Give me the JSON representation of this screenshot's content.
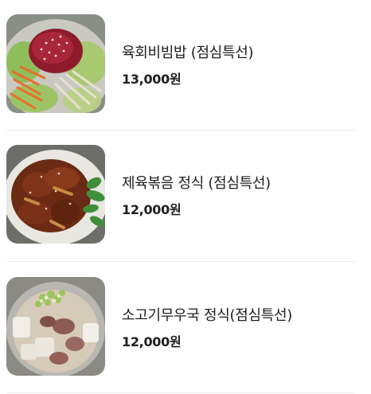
{
  "menu": {
    "items": [
      {
        "name": "육회비빔밥 (점심특선)",
        "price": "13,000원",
        "image": "yukhoe-bibimbap-photo"
      },
      {
        "name": "제육볶음 정식 (점심특선)",
        "price": "12,000원",
        "image": "jeyuk-bokkeum-photo"
      },
      {
        "name": "소고기무우국 정식(점심특선)",
        "price": "12,000원",
        "image": "beef-radish-soup-photo"
      }
    ]
  }
}
